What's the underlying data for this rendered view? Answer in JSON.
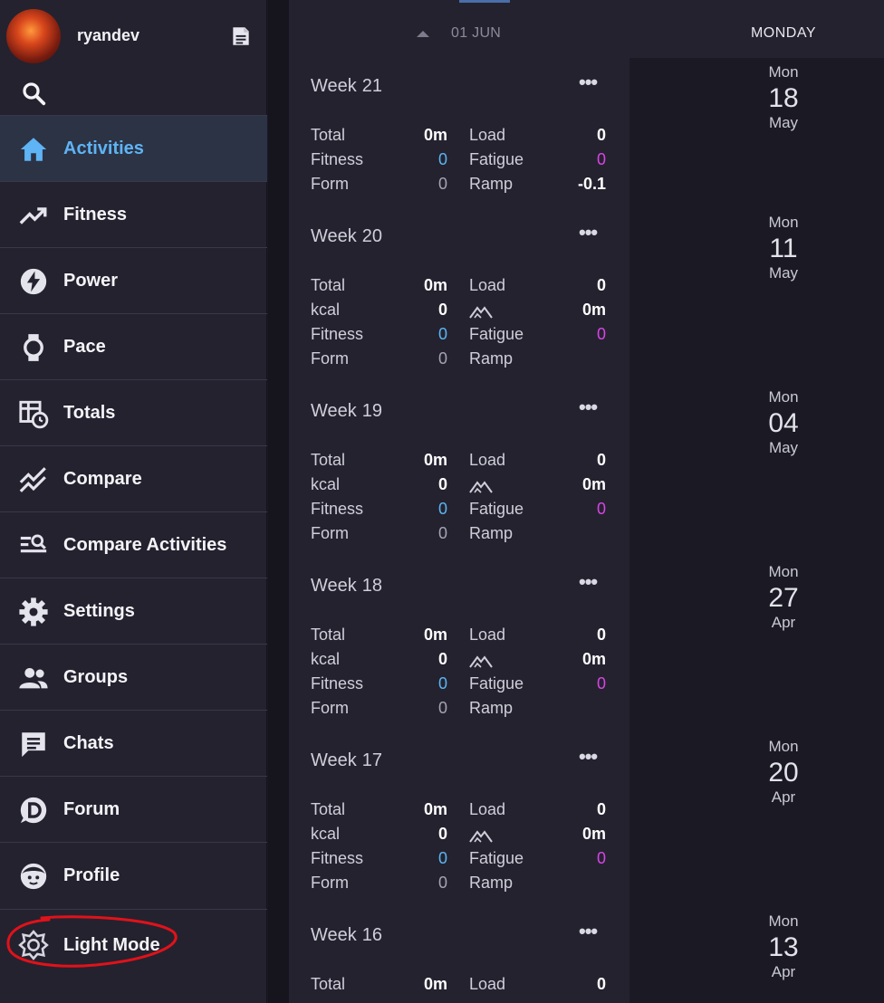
{
  "user": {
    "name": "ryandev"
  },
  "nav": [
    {
      "label": "Activities",
      "icon": "home-icon",
      "active": true
    },
    {
      "label": "Fitness",
      "icon": "trending-up-icon"
    },
    {
      "label": "Power",
      "icon": "bolt-icon"
    },
    {
      "label": "Pace",
      "icon": "watch-icon"
    },
    {
      "label": "Totals",
      "icon": "table-clock-icon"
    },
    {
      "label": "Compare",
      "icon": "compare-lines-icon"
    },
    {
      "label": "Compare Activities",
      "icon": "list-search-icon"
    },
    {
      "label": "Settings",
      "icon": "gear-icon"
    },
    {
      "label": "Groups",
      "icon": "people-icon"
    },
    {
      "label": "Chats",
      "icon": "chat-icon"
    },
    {
      "label": "Forum",
      "icon": "discourse-icon"
    },
    {
      "label": "Profile",
      "icon": "face-icon"
    }
  ],
  "light_mode": {
    "label": "Light Mode"
  },
  "date_header": "01 JUN",
  "calendar_header": "MONDAY",
  "weeks": [
    {
      "label": "Week",
      "number": "21",
      "rows": [
        {
          "k1": "Total",
          "v1": "0m",
          "k2": "Load",
          "v2": "0"
        },
        {
          "k1": "Fitness",
          "v1": "0",
          "k2": "Fatigue",
          "v2": "0"
        },
        {
          "k1": "Form",
          "v1": "0",
          "k2": "Ramp",
          "v2": "-0.1"
        }
      ]
    },
    {
      "label": "Week",
      "number": "20",
      "rows": [
        {
          "k1": "Total",
          "v1": "0m",
          "k2": "Load",
          "v2": "0"
        },
        {
          "k1": "kcal",
          "v1": "0",
          "k2": "",
          "v2": "0m"
        },
        {
          "k1": "Fitness",
          "v1": "0",
          "k2": "Fatigue",
          "v2": "0"
        },
        {
          "k1": "Form",
          "v1": "0",
          "k2": "Ramp",
          "v2": ""
        }
      ]
    },
    {
      "label": "Week",
      "number": "19",
      "rows": [
        {
          "k1": "Total",
          "v1": "0m",
          "k2": "Load",
          "v2": "0"
        },
        {
          "k1": "kcal",
          "v1": "0",
          "k2": "",
          "v2": "0m"
        },
        {
          "k1": "Fitness",
          "v1": "0",
          "k2": "Fatigue",
          "v2": "0"
        },
        {
          "k1": "Form",
          "v1": "0",
          "k2": "Ramp",
          "v2": ""
        }
      ]
    },
    {
      "label": "Week",
      "number": "18",
      "rows": [
        {
          "k1": "Total",
          "v1": "0m",
          "k2": "Load",
          "v2": "0"
        },
        {
          "k1": "kcal",
          "v1": "0",
          "k2": "",
          "v2": "0m"
        },
        {
          "k1": "Fitness",
          "v1": "0",
          "k2": "Fatigue",
          "v2": "0"
        },
        {
          "k1": "Form",
          "v1": "0",
          "k2": "Ramp",
          "v2": ""
        }
      ]
    },
    {
      "label": "Week",
      "number": "17",
      "rows": [
        {
          "k1": "Total",
          "v1": "0m",
          "k2": "Load",
          "v2": "0"
        },
        {
          "k1": "kcal",
          "v1": "0",
          "k2": "",
          "v2": "0m"
        },
        {
          "k1": "Fitness",
          "v1": "0",
          "k2": "Fatigue",
          "v2": "0"
        },
        {
          "k1": "Form",
          "v1": "0",
          "k2": "Ramp",
          "v2": ""
        }
      ]
    },
    {
      "label": "Week",
      "number": "16",
      "rows": [
        {
          "k1": "Total",
          "v1": "0m",
          "k2": "Load",
          "v2": "0"
        }
      ]
    }
  ],
  "days": [
    {
      "dow": "Mon",
      "day": "18",
      "month": "May"
    },
    {
      "dow": "Mon",
      "day": "11",
      "month": "May"
    },
    {
      "dow": "Mon",
      "day": "04",
      "month": "May"
    },
    {
      "dow": "Mon",
      "day": "27",
      "month": "Apr"
    },
    {
      "dow": "Mon",
      "day": "20",
      "month": "Apr"
    },
    {
      "dow": "Mon",
      "day": "13",
      "month": "Apr"
    }
  ],
  "colors": {
    "accent": "#5eb4f4",
    "fitness": "#5ab6f2",
    "fatigue": "#d844e6",
    "highlight": "#e0121a"
  }
}
